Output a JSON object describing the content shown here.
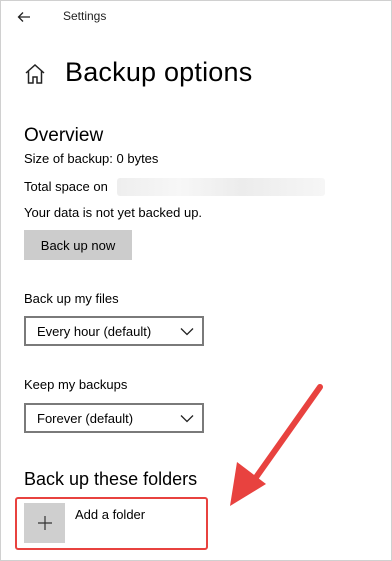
{
  "titlebar": {
    "app_title": "Settings",
    "back_icon": "back-arrow-icon"
  },
  "page": {
    "title": "Backup options",
    "home_icon": "home-icon"
  },
  "overview": {
    "heading": "Overview",
    "size_of_backup": "Size of backup: 0 bytes",
    "total_space_label": "Total space on",
    "status": "Your data is not yet backed up.",
    "back_up_now_label": "Back up now"
  },
  "schedule": {
    "label": "Back up my files",
    "selected": "Every hour (default)"
  },
  "retention": {
    "label": "Keep my backups",
    "selected": "Forever (default)"
  },
  "folders": {
    "heading": "Back up these folders",
    "add_label": "Add a folder",
    "add_icon": "plus-icon"
  },
  "colors": {
    "highlight": "#e8423f",
    "button_bg": "#cccccc",
    "dropdown_border": "#7a7a7a"
  }
}
